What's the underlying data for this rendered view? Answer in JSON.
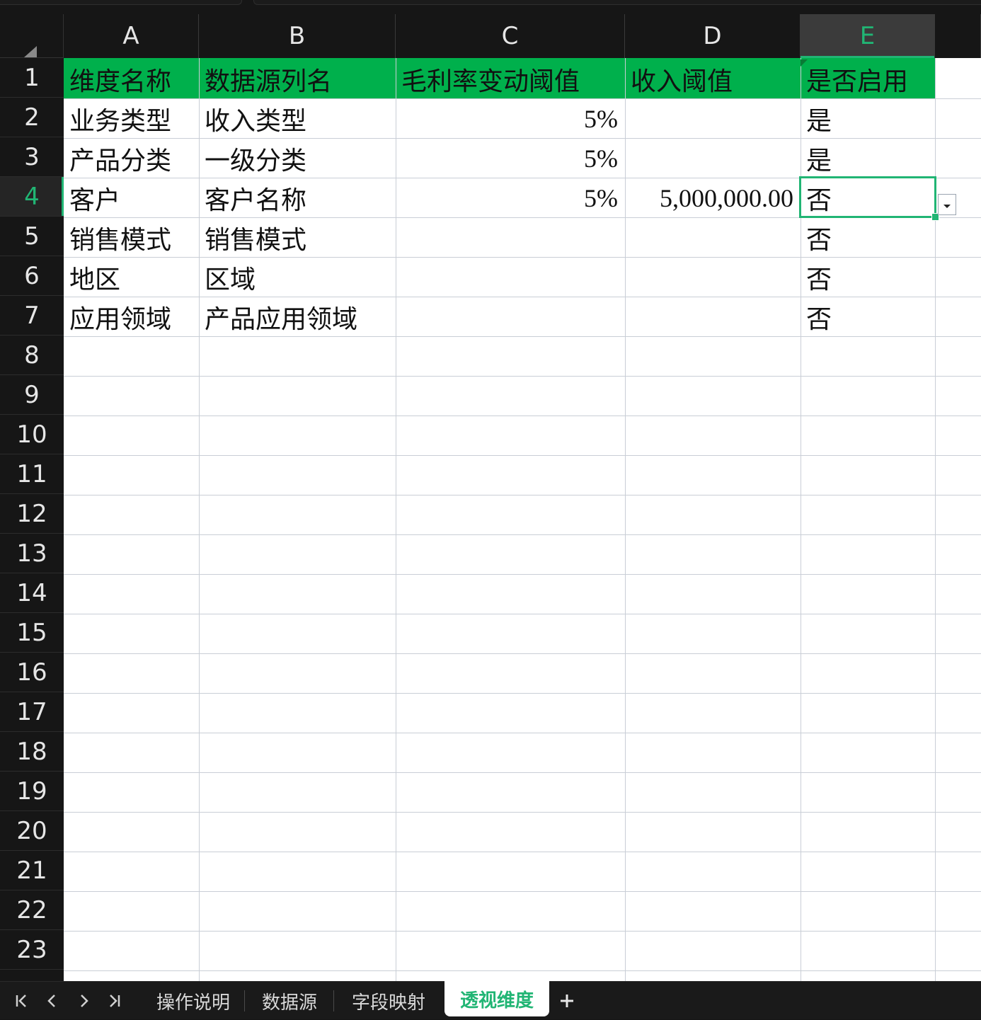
{
  "sheet": {
    "columns": [
      "A",
      "B",
      "C",
      "D",
      "E"
    ],
    "active_column": "E",
    "row_numbers": [
      "1",
      "2",
      "3",
      "4",
      "5",
      "6",
      "7",
      "8",
      "9",
      "10",
      "11",
      "12",
      "13",
      "14",
      "15",
      "16",
      "17",
      "18",
      "19",
      "20",
      "21",
      "22",
      "23"
    ],
    "active_row": "4",
    "header_row": [
      "维度名称",
      "数据源列名",
      "毛利率变动阈值",
      "收入阈值",
      "是否启用"
    ],
    "rows": [
      [
        "业务类型",
        "收入类型",
        "5%",
        "",
        "是"
      ],
      [
        "产品分类",
        "一级分类",
        "5%",
        "",
        "是"
      ],
      [
        "客户",
        "客户名称",
        "5%",
        "5,000,000.00",
        "否"
      ],
      [
        "销售模式",
        "销售模式",
        "",
        "",
        "否"
      ],
      [
        "地区",
        "区域",
        "",
        "",
        "否"
      ],
      [
        "应用领域",
        "产品应用领域",
        "",
        "",
        "否"
      ]
    ],
    "selected_cell": "E4",
    "header_fill_color": "#00b04c",
    "accent_color": "#21b574"
  },
  "tabs": {
    "nav": [
      "first-sheet-icon",
      "prev-sheet-icon",
      "next-sheet-icon",
      "last-sheet-icon"
    ],
    "items": [
      {
        "label": "操作说明",
        "active": false
      },
      {
        "label": "数据源",
        "active": false
      },
      {
        "label": "字段映射",
        "active": false
      },
      {
        "label": "透视维度",
        "active": true
      }
    ],
    "add_icon": "plus-icon"
  }
}
